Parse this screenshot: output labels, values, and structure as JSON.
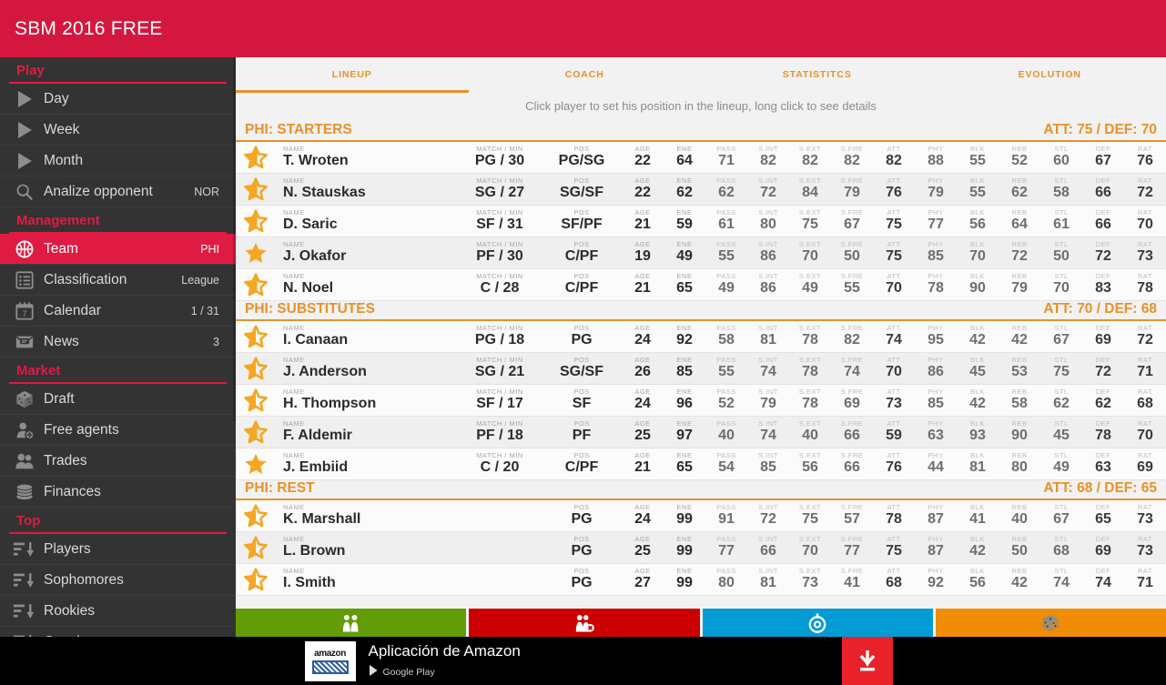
{
  "app": {
    "title": "SBM 2016 FREE",
    "accent_red": "#d4173f",
    "accent_orange": "#e8912a"
  },
  "sidebar": {
    "sections": [
      {
        "title": "Play",
        "items": [
          {
            "label": "Day",
            "value": "",
            "icon": "play-triangle-icon",
            "active": false
          },
          {
            "label": "Week",
            "value": "",
            "icon": "play-triangle-icon",
            "active": false
          },
          {
            "label": "Month",
            "value": "",
            "icon": "play-triangle-icon",
            "active": false
          },
          {
            "label": "Analize opponent",
            "value": "NOR",
            "icon": "magnifier-icon",
            "active": false
          }
        ]
      },
      {
        "title": "Management",
        "items": [
          {
            "label": "Team",
            "value": "PHI",
            "icon": "basketball-icon",
            "active": true
          },
          {
            "label": "Classification",
            "value": "League",
            "icon": "list-icon",
            "active": false
          },
          {
            "label": "Calendar",
            "value": "1 / 31",
            "icon": "calendar-icon",
            "active": false
          },
          {
            "label": "News",
            "value": "3",
            "icon": "envelope-icon",
            "active": false
          }
        ]
      },
      {
        "title": "Market",
        "items": [
          {
            "label": "Draft",
            "value": "",
            "icon": "dice-icon",
            "active": false
          },
          {
            "label": "Free agents",
            "value": "",
            "icon": "person-plus-icon",
            "active": false
          },
          {
            "label": "Trades",
            "value": "",
            "icon": "people-icon",
            "active": false
          },
          {
            "label": "Finances",
            "value": "",
            "icon": "coins-icon",
            "active": false
          }
        ]
      },
      {
        "title": "Top",
        "items": [
          {
            "label": "Players",
            "value": "",
            "icon": "ranking-down-icon",
            "active": false
          },
          {
            "label": "Sophomores",
            "value": "",
            "icon": "ranking-down-icon",
            "active": false
          },
          {
            "label": "Rookies",
            "value": "",
            "icon": "ranking-down-icon",
            "active": false
          },
          {
            "label": "Coaches",
            "value": "",
            "icon": "ranking-down-icon",
            "active": false
          }
        ]
      }
    ]
  },
  "main": {
    "tabs": [
      {
        "label": "LINEUP",
        "active": true
      },
      {
        "label": "COACH",
        "active": false
      },
      {
        "label": "STATISTITCS",
        "active": false
      },
      {
        "label": "EVOLUTION",
        "active": false
      }
    ],
    "hint": "Click player to set his position in the lineup, long click to see details",
    "columns": {
      "name": "NAME",
      "match_min": "MATCH / MIN",
      "pos": "POS",
      "age": "AGE",
      "ene": "ENE",
      "stats": [
        "PASS",
        "S.INT",
        "S.EXT",
        "S.FRE",
        "ATT",
        "PHY",
        "BLK",
        "REB",
        "STL",
        "DEF",
        "RAT"
      ]
    },
    "groups": [
      {
        "name": "PHI: STARTERS",
        "rating": "ATT: 75  /  DEF: 70",
        "show_match_min": true,
        "rows": [
          {
            "star": "full-left-half-right",
            "name": "T. Wroten",
            "match_min": "PG / 30",
            "pos": "PG/SG",
            "age": "22",
            "ene": "64",
            "stats": [
              "71",
              "82",
              "82",
              "82",
              "82",
              "88",
              "55",
              "52",
              "60",
              "67",
              "76"
            ]
          },
          {
            "star": "full-left-half-right",
            "name": "N. Stauskas",
            "match_min": "SG / 27",
            "pos": "SG/SF",
            "age": "22",
            "ene": "62",
            "stats": [
              "62",
              "72",
              "84",
              "79",
              "76",
              "79",
              "55",
              "62",
              "58",
              "66",
              "72"
            ]
          },
          {
            "star": "full-left-half-right",
            "name": "D. Saric",
            "match_min": "SF / 31",
            "pos": "SF/PF",
            "age": "21",
            "ene": "59",
            "stats": [
              "61",
              "80",
              "75",
              "67",
              "75",
              "77",
              "56",
              "64",
              "61",
              "66",
              "70"
            ]
          },
          {
            "star": "full",
            "name": "J. Okafor",
            "match_min": "PF / 30",
            "pos": "C/PF",
            "age": "19",
            "ene": "49",
            "stats": [
              "55",
              "86",
              "70",
              "50",
              "75",
              "85",
              "70",
              "72",
              "50",
              "72",
              "73"
            ]
          },
          {
            "star": "full-left-half-right",
            "name": "N. Noel",
            "match_min": "C / 28",
            "pos": "C/PF",
            "age": "21",
            "ene": "65",
            "stats": [
              "49",
              "86",
              "49",
              "55",
              "70",
              "78",
              "90",
              "79",
              "70",
              "83",
              "78"
            ]
          }
        ]
      },
      {
        "name": "PHI: SUBSTITUTES",
        "rating": "ATT: 70  /  DEF: 68",
        "show_match_min": true,
        "rows": [
          {
            "star": "half",
            "name": "I. Canaan",
            "match_min": "PG / 18",
            "pos": "PG",
            "age": "24",
            "ene": "92",
            "stats": [
              "58",
              "81",
              "78",
              "82",
              "74",
              "95",
              "42",
              "42",
              "67",
              "69",
              "72"
            ]
          },
          {
            "star": "half",
            "name": "J. Anderson",
            "match_min": "SG / 21",
            "pos": "SG/SF",
            "age": "26",
            "ene": "85",
            "stats": [
              "55",
              "74",
              "78",
              "74",
              "70",
              "86",
              "45",
              "53",
              "75",
              "72",
              "71"
            ]
          },
          {
            "star": "half",
            "name": "H. Thompson",
            "match_min": "SF / 17",
            "pos": "SF",
            "age": "24",
            "ene": "96",
            "stats": [
              "52",
              "79",
              "78",
              "69",
              "73",
              "85",
              "42",
              "58",
              "62",
              "62",
              "68"
            ]
          },
          {
            "star": "full-left-half-right",
            "name": "F. Aldemir",
            "match_min": "PF / 18",
            "pos": "PF",
            "age": "25",
            "ene": "97",
            "stats": [
              "40",
              "74",
              "40",
              "66",
              "59",
              "63",
              "93",
              "90",
              "45",
              "78",
              "70"
            ]
          },
          {
            "star": "full",
            "name": "J. Embiid",
            "match_min": "C / 20",
            "pos": "C/PF",
            "age": "21",
            "ene": "65",
            "stats": [
              "54",
              "85",
              "56",
              "66",
              "76",
              "44",
              "81",
              "80",
              "49",
              "63",
              "69"
            ]
          }
        ]
      },
      {
        "name": "PHI: REST",
        "rating": "ATT: 68  /  DEF: 65",
        "show_match_min": false,
        "rows": [
          {
            "star": "half",
            "name": "K. Marshall",
            "match_min": "",
            "pos": "PG",
            "age": "24",
            "ene": "99",
            "stats": [
              "91",
              "72",
              "75",
              "57",
              "78",
              "87",
              "41",
              "40",
              "67",
              "65",
              "73"
            ]
          },
          {
            "star": "half",
            "name": "L. Brown",
            "match_min": "",
            "pos": "PG",
            "age": "25",
            "ene": "99",
            "stats": [
              "77",
              "66",
              "70",
              "77",
              "75",
              "87",
              "42",
              "50",
              "68",
              "69",
              "73"
            ]
          },
          {
            "star": "half",
            "name": "I. Smith",
            "match_min": "",
            "pos": "PG",
            "age": "27",
            "ene": "99",
            "stats": [
              "80",
              "81",
              "73",
              "41",
              "68",
              "92",
              "56",
              "42",
              "74",
              "74",
              "71"
            ]
          }
        ]
      }
    ],
    "actions": [
      {
        "icon": "players-icon",
        "color": "#629c06"
      },
      {
        "icon": "players-remove-icon",
        "color": "#cc0000"
      },
      {
        "icon": "whistle-icon",
        "color": "#039bd4"
      },
      {
        "icon": "dice-icon",
        "color": "#f18d04"
      }
    ]
  },
  "ad": {
    "logo_text": "amazon",
    "title": "Aplicación de Amazon",
    "store": "Google Play",
    "download_icon": "download-icon"
  }
}
